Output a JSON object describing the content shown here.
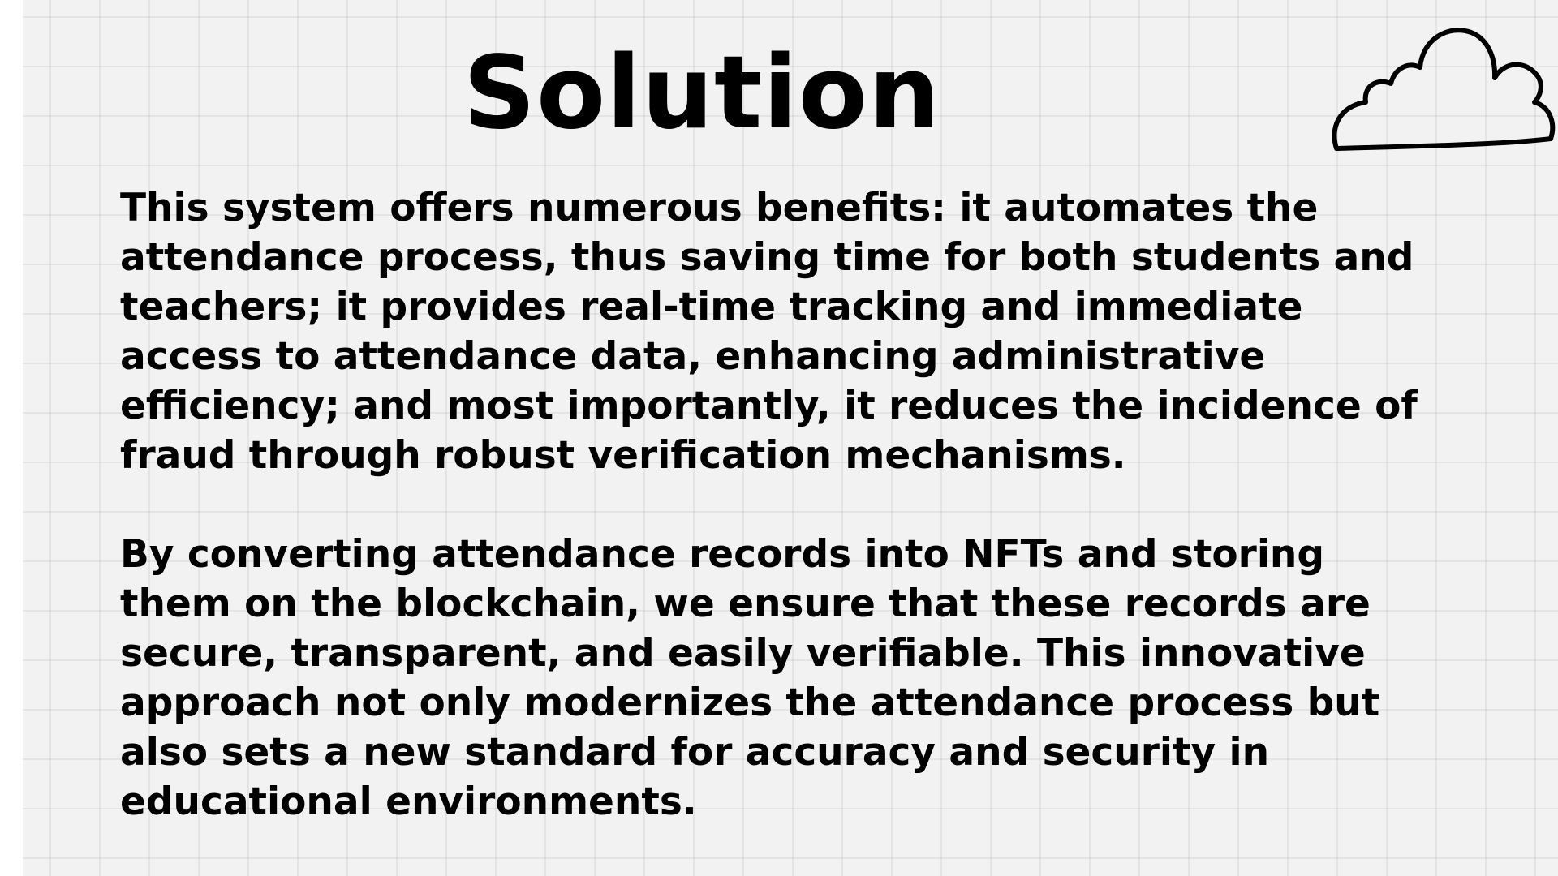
{
  "slide": {
    "title": "Solution",
    "paragraphs": [
      "This system offers numerous benefits: it automates the attendance process, thus saving time for both students and teachers; it provides real-time tracking and immediate access to attendance data, enhancing administrative efficiency; and most importantly, it reduces the incidence of fraud through robust verification mechanisms.",
      "By converting attendance records into NFTs and storing them on the blockchain, we ensure that these records are secure, transparent, and easily verifiable. This innovative approach not only modernizes the attendance process but also sets a new standard for accuracy and security in educational environments."
    ],
    "decoration_icon": "cloud-icon"
  },
  "colors": {
    "background": "#f2f2f2",
    "grid_line": "#e0e0e0",
    "text": "#000000"
  }
}
